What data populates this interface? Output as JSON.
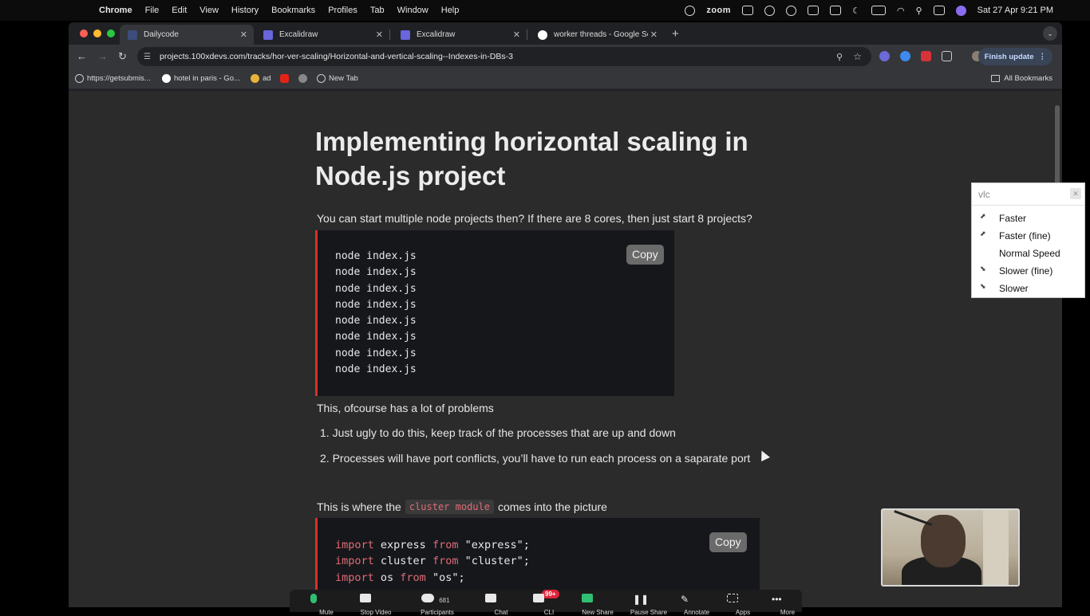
{
  "menubar": {
    "app": "Chrome",
    "menus": [
      "File",
      "Edit",
      "View",
      "History",
      "Bookmarks",
      "Profiles",
      "Tab",
      "Window",
      "Help"
    ],
    "zoom_label": "zoom",
    "clock": "Sat 27 Apr  9:21 PM"
  },
  "tabs": [
    {
      "title": "Dailycode",
      "active": true
    },
    {
      "title": "Excalidraw",
      "active": false
    },
    {
      "title": "Excalidraw",
      "active": false
    },
    {
      "title": "worker threads - Google Sea",
      "active": false
    }
  ],
  "toolbar": {
    "url": "projects.100xdevs.com/tracks/hor-ver-scaling/Horizontal-and-vertical-scaling--Indexes-in-DBs-3",
    "finish_update": "Finish update"
  },
  "bookmarks": {
    "items": [
      "https://getsubmis...",
      "hotel in paris - Go...",
      "ad",
      "",
      "",
      "New Tab"
    ],
    "all": "All Bookmarks"
  },
  "article": {
    "title": "Implementing horizontal scaling in Node.js project",
    "intro": "You can start multiple node projects then? If there are 8 cores, then just start 8 projects?",
    "code1_lines": [
      "node index.js",
      "node index.js",
      "node index.js",
      "node index.js",
      "node index.js",
      "node index.js",
      "node index.js",
      "node index.js"
    ],
    "copy_label": "Copy",
    "problems_text": "This, ofcourse has a lot of problems",
    "list": [
      "1.  Just ugly to do this, keep track of the processes that are up and down",
      "2.  Processes will have port conflicts, you’ll have to run each process on a saparate port"
    ],
    "cluster_before": "This is where the",
    "cluster_code": "cluster module",
    "cluster_after": "comes into the picture",
    "code2": [
      {
        "kw1": "import",
        "name": " express ",
        "kw2": "from",
        "str": " \"express\";"
      },
      {
        "kw1": "import",
        "name": " cluster ",
        "kw2": "from",
        "str": " \"cluster\";"
      },
      {
        "kw1": "import",
        "name": " os ",
        "kw2": "from",
        "str": " \"os\";"
      }
    ]
  },
  "vlc": {
    "search": "vlc",
    "items": [
      "Faster",
      "Faster (fine)",
      "Normal Speed",
      "Slower (fine)",
      "Slower"
    ]
  },
  "zoom_toolbar": {
    "labels": [
      "Mute",
      "Stop Video",
      "Participants",
      "Chat",
      "CLI",
      "New Share",
      "Pause Share",
      "Annotate",
      "Apps",
      "More"
    ],
    "participants_count": "681",
    "badge": "99+"
  }
}
